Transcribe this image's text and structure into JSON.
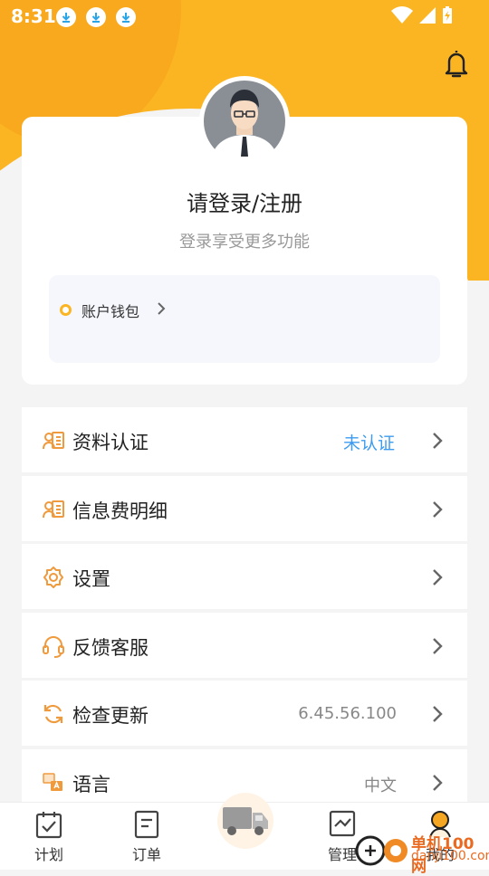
{
  "status_bar": {
    "time": "8:31"
  },
  "profile": {
    "login_text": "请登录/注册",
    "subtitle": "登录享受更多功能",
    "wallet_label": "账户钱包"
  },
  "menu": [
    {
      "label": "资料认证",
      "value": "未认证",
      "icon": "id-card-icon"
    },
    {
      "label": "信息费明细",
      "value": "",
      "icon": "id-card-icon"
    },
    {
      "label": "设置",
      "value": "",
      "icon": "gear-icon"
    },
    {
      "label": "反馈客服",
      "value": "",
      "icon": "headset-icon"
    },
    {
      "label": "检查更新",
      "value": "6.45.56.100",
      "icon": "refresh-icon"
    },
    {
      "label": "语言",
      "value": "中文",
      "icon": "language-icon"
    }
  ],
  "tabs": [
    {
      "label": "计划"
    },
    {
      "label": "订单"
    },
    {
      "label": ""
    },
    {
      "label": "管理"
    },
    {
      "label": "我的"
    }
  ],
  "watermark": {
    "line1": "单机100网",
    "line2": "danji100.com"
  },
  "colors": {
    "accent": "#fbb522",
    "link_blue": "#3d9bf0",
    "icon_orange": "#f09a3e"
  }
}
